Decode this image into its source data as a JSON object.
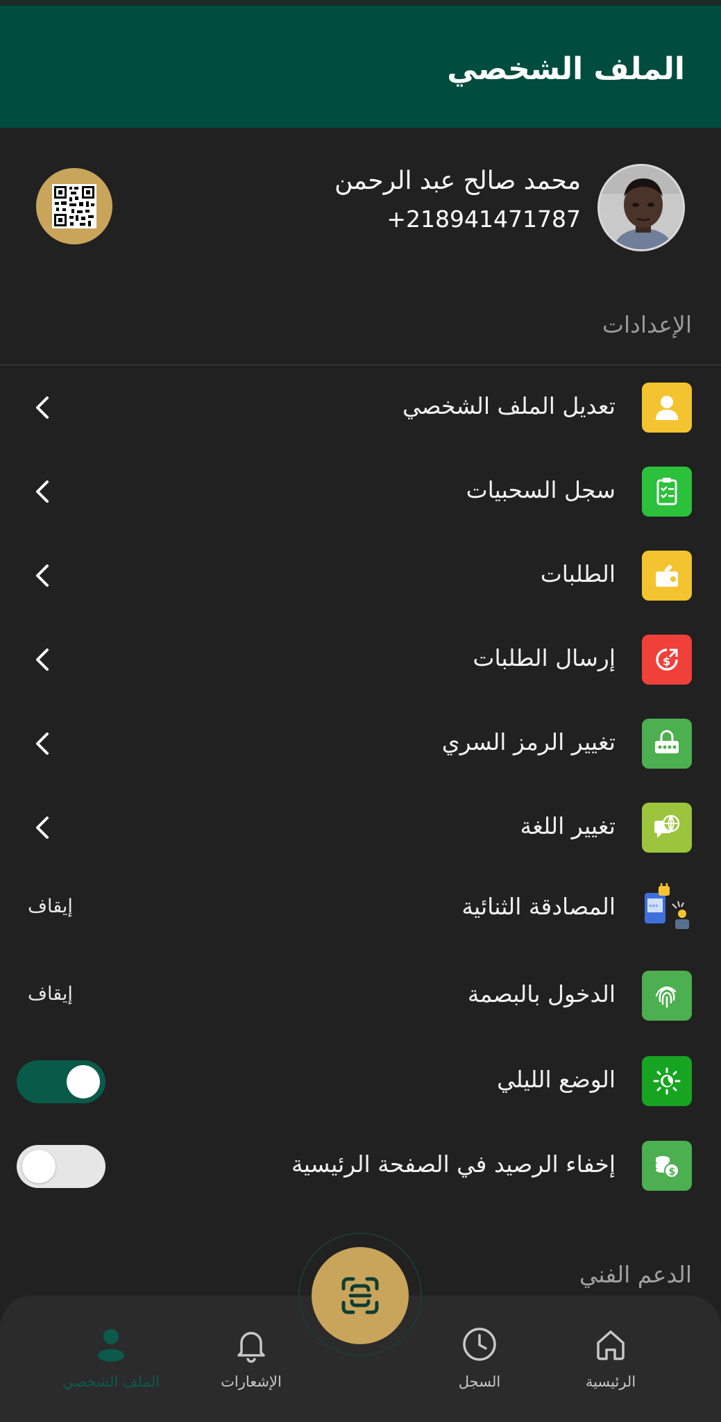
{
  "header": {
    "title": "الملف الشخصي"
  },
  "profile": {
    "name": "محمد صالح عبد الرحمن",
    "phone": "+218941471787"
  },
  "sections": {
    "settings": "الإعدادات",
    "support": "الدعم الفني"
  },
  "settings_items": [
    {
      "label": "تعديل الملف الشخصي",
      "icon": "user-icon",
      "icon_bg": "#f4c430"
    },
    {
      "label": "سجل السحبيات",
      "icon": "clipboard-icon",
      "icon_bg": "#2cc13b"
    },
    {
      "label": "الطلبات",
      "icon": "wallet-icon",
      "icon_bg": "#f4c430"
    },
    {
      "label": "إرسال الطلبات",
      "icon": "send-money-icon",
      "icon_bg": "#f0403a"
    },
    {
      "label": "تغيير الرمز السري",
      "icon": "password-icon",
      "icon_bg": "#4caf50"
    },
    {
      "label": "تغيير اللغة",
      "icon": "language-icon",
      "icon_bg": "#9cc43c"
    }
  ],
  "security_items": [
    {
      "label": "المصادقة الثنائية",
      "state": "إيقاف",
      "icon": "two-factor-icon"
    },
    {
      "label": "الدخول بالبصمة",
      "state": "إيقاف",
      "icon": "fingerprint-icon",
      "icon_bg": "#4caf50"
    }
  ],
  "toggle_items": [
    {
      "label": "الوضع الليلي",
      "enabled": true,
      "icon": "night-mode-icon",
      "icon_bg": "#17a421"
    },
    {
      "label": "إخفاء الرصيد في الصفحة الرئيسية",
      "enabled": false,
      "icon": "hide-balance-icon",
      "icon_bg": "#4caf50"
    }
  ],
  "bottom_nav": {
    "home": "الرئيسية",
    "history": "السجل",
    "notifications": "الإشعارات",
    "profile": "الملف الشخصي"
  },
  "colors": {
    "header_bg": "#004c3f",
    "page_bg": "#212121",
    "accent_gold": "#c9a55b",
    "toggle_on": "#0a5a4a",
    "toggle_off": "#e6e6e6"
  }
}
